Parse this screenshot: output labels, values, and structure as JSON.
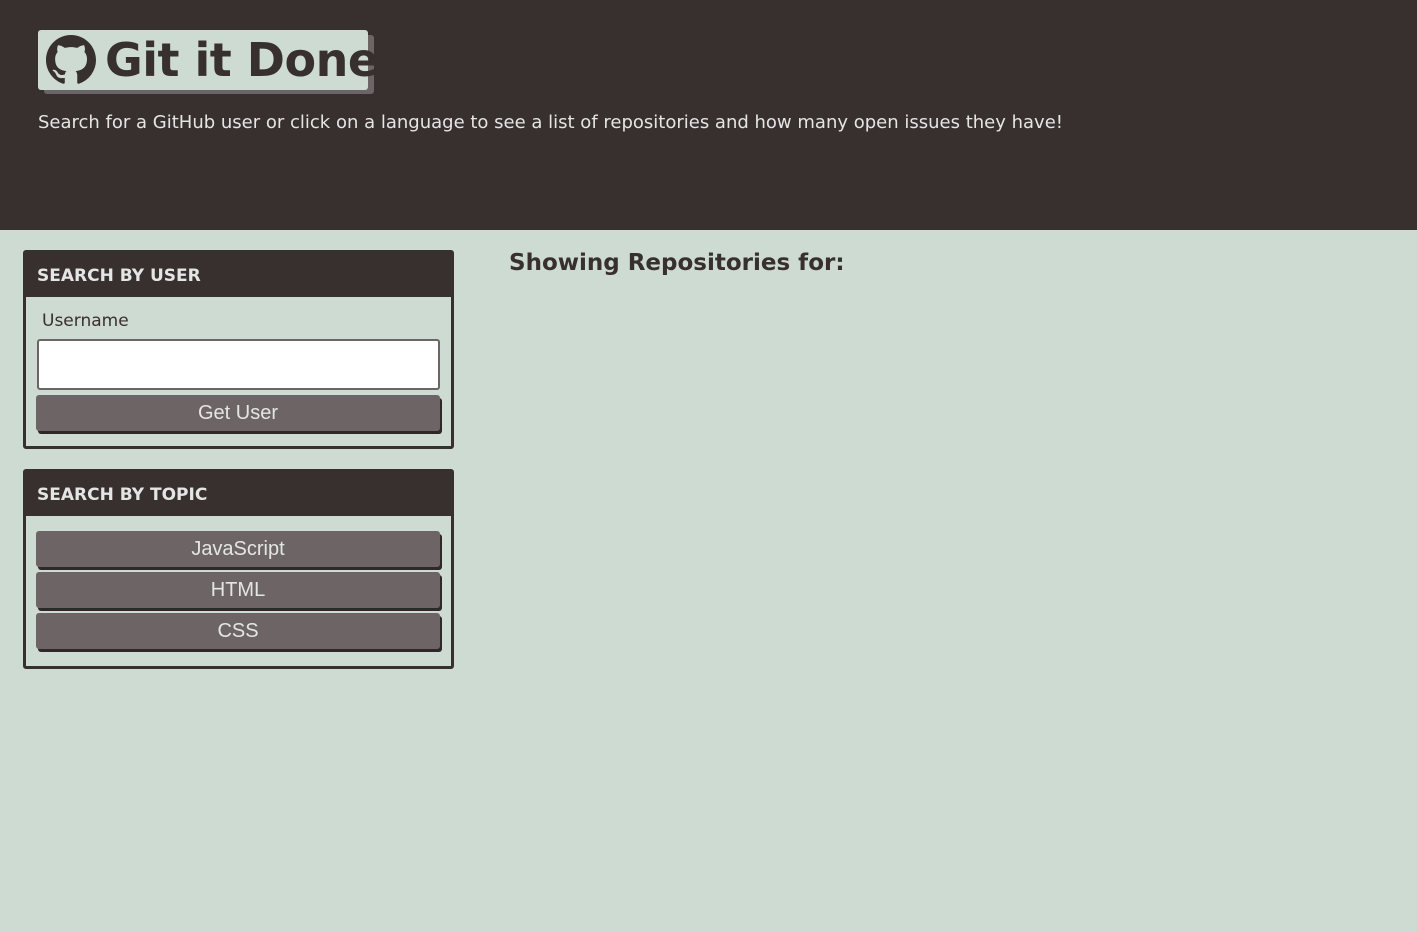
{
  "header": {
    "logo_icon": "github-octocat-icon",
    "title": "Git it Done!",
    "subtitle": "Search for a GitHub user or click on a language to see a list of repositories and how many open issues they have!"
  },
  "user_search": {
    "heading": "SEARCH BY USER",
    "username_label": "Username",
    "username_value": "",
    "username_placeholder": "",
    "submit_label": "Get User"
  },
  "topic_search": {
    "heading": "SEARCH BY TOPIC",
    "languages": [
      "JavaScript",
      "HTML",
      "CSS"
    ]
  },
  "repos": {
    "heading": "Showing Repositories for:",
    "search_term": ""
  },
  "colors": {
    "dark": "#382f2f",
    "background": "#cddbd2",
    "button": "#6d6565",
    "light_text": "#e4e6e4"
  }
}
